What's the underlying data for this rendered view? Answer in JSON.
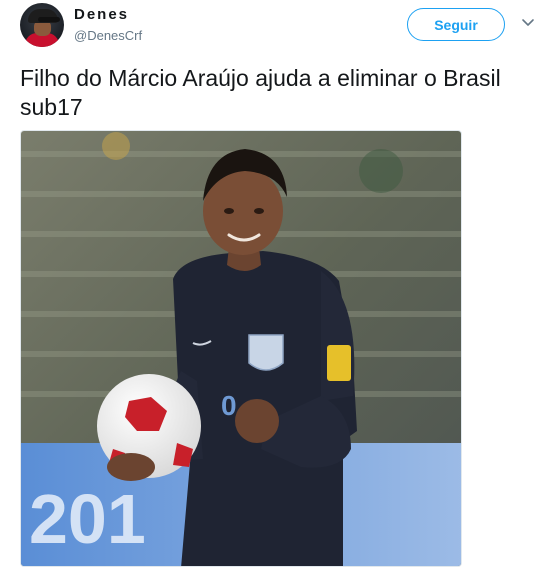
{
  "user": {
    "display_name": "Denes",
    "handle": "@DenesCrf"
  },
  "actions": {
    "follow_label": "Seguir"
  },
  "tweet": {
    "text": "Filho do Márcio Araújo ajuda a eliminar o Brasil sub17"
  },
  "media": {
    "board_text": "201",
    "shirt_number": "0"
  },
  "icons": {
    "avatar": "avatar-photo",
    "menu": "chevron-down-icon"
  },
  "colors": {
    "accent": "#1da1f2",
    "text": "#14171a",
    "secondary": "#657786"
  }
}
